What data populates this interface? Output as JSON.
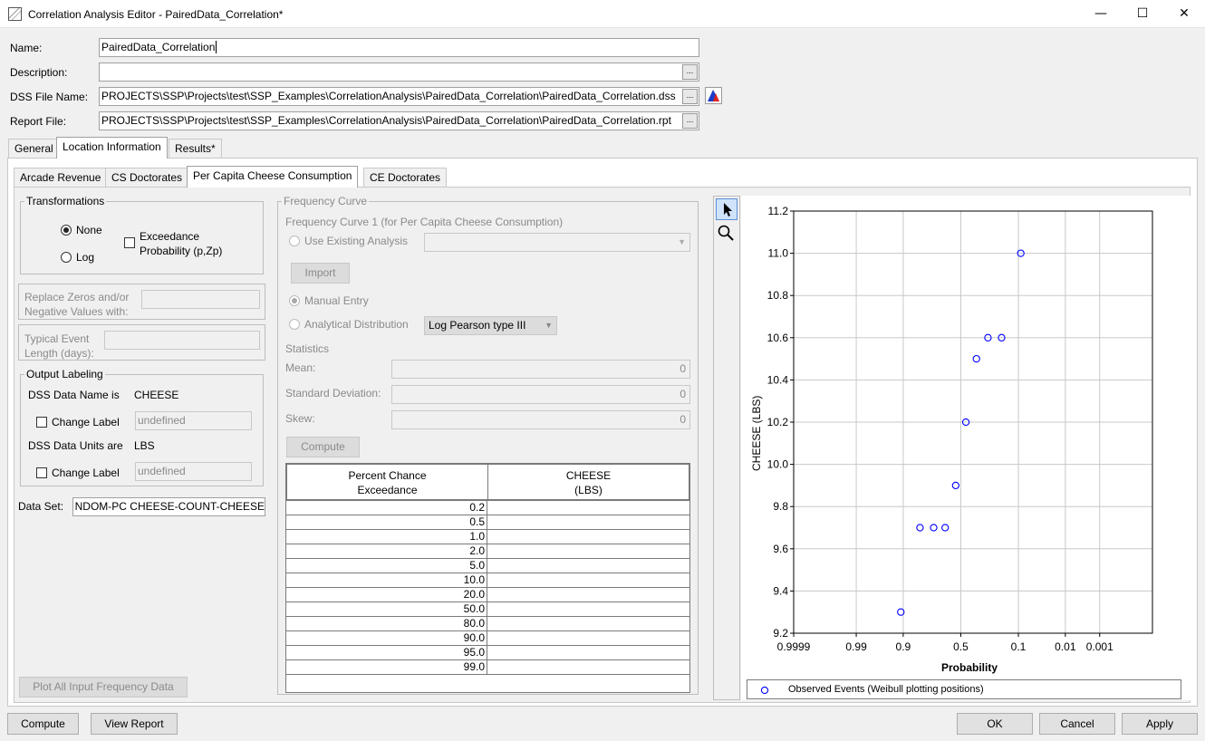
{
  "window": {
    "title": "Correlation Analysis Editor - PairedData_Correlation*",
    "minimize": "—",
    "maximize": "☐",
    "close": "✕"
  },
  "form": {
    "name_label": "Name:",
    "name_value": "PairedData_Correlation",
    "description_label": "Description:",
    "description_value": "",
    "dss_label": "DSS File Name:",
    "dss_value": "PROJECTS\\SSP\\Projects\\test\\SSP_Examples\\CorrelationAnalysis\\PairedData_Correlation\\PairedData_Correlation.dss",
    "report_label": "Report File:",
    "report_value": "PROJECTS\\SSP\\Projects\\test\\SSP_Examples\\CorrelationAnalysis\\PairedData_Correlation\\PairedData_Correlation.rpt",
    "browse": "..."
  },
  "tabs": [
    "General",
    "Location Information",
    "Results*"
  ],
  "subtabs": [
    "Arcade Revenue",
    "CS Doctorates",
    "Per Capita Cheese Consumption",
    "CE Doctorates"
  ],
  "transformations": {
    "title": "Transformations",
    "none": "None",
    "log": "Log",
    "exceedance": "Exceedance",
    "exceedance2": "Probability (p,Zp)",
    "selected": "None"
  },
  "replace_zeros": {
    "line1": "Replace Zeros and/or",
    "line2": "Negative Values with:",
    "value": ""
  },
  "event_length": {
    "line1": "Typical Event",
    "line2": "Length (days):",
    "value": ""
  },
  "output_labeling": {
    "title": "Output Labeling",
    "dss_name_label": "DSS Data Name is",
    "dss_name_value": "CHEESE",
    "change_label": "Change Label",
    "name_placeholder": "undefined",
    "dss_units_label": "DSS Data Units are",
    "dss_units_value": "LBS",
    "units_placeholder": "undefined"
  },
  "data_set": {
    "label": "Data Set:",
    "value": "NDOM-PC CHEESE-COUNT-CHEESE"
  },
  "plot_all_button": "Plot All Input Frequency Data",
  "frequency_curve": {
    "title": "Frequency Curve",
    "subtitle": "Frequency Curve 1 (for Per Capita Cheese Consumption)",
    "use_existing": "Use Existing Analysis",
    "import": "Import",
    "manual_entry": "Manual Entry",
    "analytical": "Analytical Distribution",
    "distribution": "Log Pearson type III",
    "statistics": "Statistics",
    "mean_label": "Mean:",
    "mean_value": "0",
    "std_label": "Standard Deviation:",
    "std_value": "0",
    "skew_label": "Skew:",
    "skew_value": "0",
    "compute": "Compute"
  },
  "table": {
    "col1_line1": "Percent Chance",
    "col1_line2": "Exceedance",
    "col2_line1": "CHEESE",
    "col2_line2": "(LBS)",
    "rows": [
      "0.2",
      "0.5",
      "1.0",
      "2.0",
      "5.0",
      "10.0",
      "20.0",
      "50.0",
      "80.0",
      "90.0",
      "95.0",
      "99.0"
    ]
  },
  "chart_data": {
    "type": "scatter",
    "xlabel": "Probability",
    "ylabel": "CHEESE (LBS)",
    "x_scale": "normal-probability (exceedance, reversed)",
    "x_ticks": [
      "0.9999",
      "0.99",
      "0.9",
      "0.5",
      "0.1",
      "0.01",
      "0.001"
    ],
    "y_ticks": [
      "9.2",
      "9.4",
      "9.6",
      "9.8",
      "10.0",
      "10.2",
      "10.4",
      "10.6",
      "10.8",
      "11.0",
      "11.2"
    ],
    "ylim": [
      9.2,
      11.2
    ],
    "grid": true,
    "legend": "bottom",
    "series": [
      {
        "name": "Observed Events (Weibull plotting positions)",
        "color": "#0000ff",
        "points": [
          {
            "x": 0.909,
            "y": 9.3
          },
          {
            "x": 0.818,
            "y": 9.7
          },
          {
            "x": 0.727,
            "y": 9.7
          },
          {
            "x": 0.636,
            "y": 9.7
          },
          {
            "x": 0.545,
            "y": 9.9
          },
          {
            "x": 0.455,
            "y": 10.2
          },
          {
            "x": 0.364,
            "y": 10.5
          },
          {
            "x": 0.273,
            "y": 10.6
          },
          {
            "x": 0.182,
            "y": 10.6
          },
          {
            "x": 0.091,
            "y": 11.0
          }
        ]
      }
    ]
  },
  "buttons": {
    "compute": "Compute",
    "view_report": "View Report",
    "ok": "OK",
    "cancel": "Cancel",
    "apply": "Apply"
  }
}
